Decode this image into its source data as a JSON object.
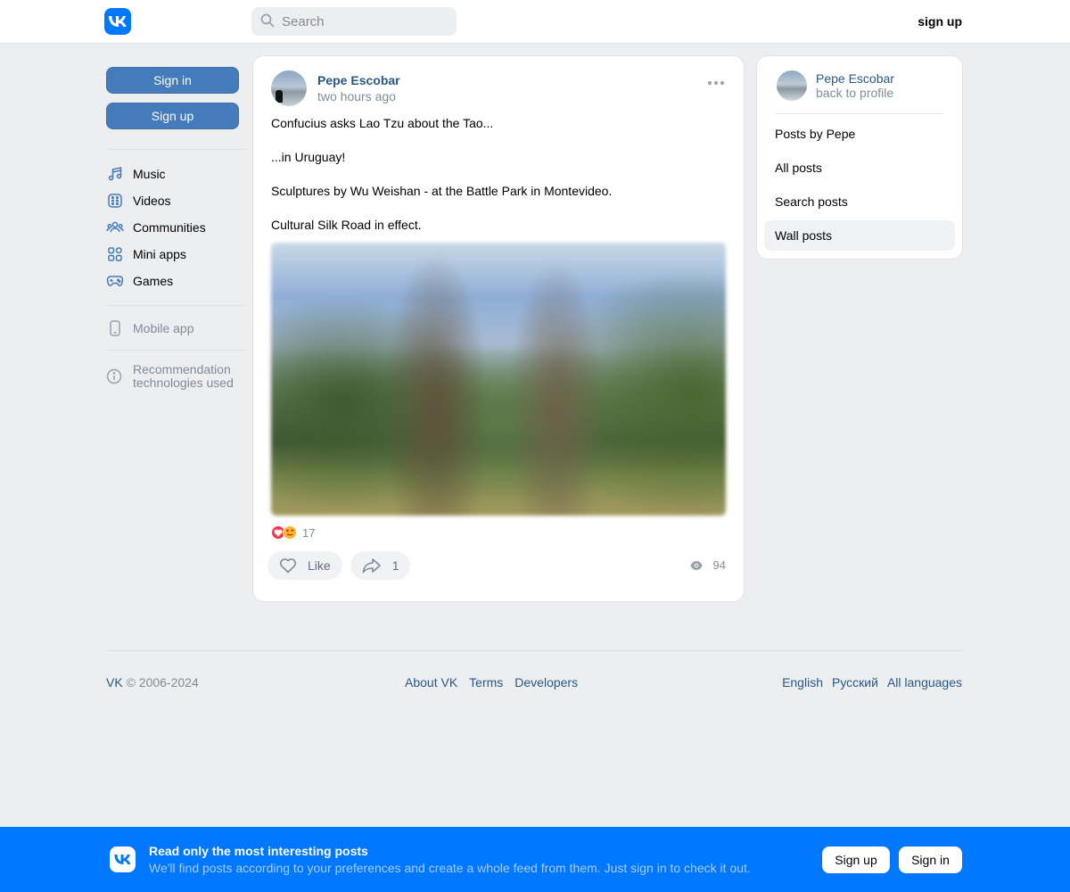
{
  "header": {
    "logo_icon": "vk-logo-icon",
    "search_placeholder": "Search",
    "signup_label": "sign up"
  },
  "sidebar": {
    "signin_label": "Sign in",
    "signup_label": "Sign up",
    "items": [
      {
        "label": "Music",
        "icon": "music-icon"
      },
      {
        "label": "Videos",
        "icon": "video-icon"
      },
      {
        "label": "Communities",
        "icon": "communities-icon"
      },
      {
        "label": "Mini apps",
        "icon": "mini-apps-icon"
      },
      {
        "label": "Games",
        "icon": "gamepad-icon"
      }
    ],
    "mobile_app": "Mobile app",
    "reco_line1": "Recommendation",
    "reco_line2": "technologies used"
  },
  "post": {
    "author": "Pepe Escobar",
    "time": "two hours ago",
    "paragraphs": [
      "Confucius asks Lao Tzu about the Tao...",
      "...in Uruguay!",
      "Sculptures by Wu Weishan - at the Battle Park in Montevideo.",
      "Cultural Silk Road in effect."
    ],
    "reactions_count": "17",
    "like_label": "Like",
    "share_count": "1",
    "views_count": "94"
  },
  "right_menu": {
    "name": "Pepe Escobar",
    "back": "back to profile",
    "items": [
      "Posts by Pepe",
      "All posts",
      "Search posts",
      "Wall posts"
    ],
    "active_index": 3
  },
  "footer": {
    "brand": "VK",
    "copyright": " © 2006-2024",
    "links": [
      "About VK",
      "Terms",
      "Developers"
    ],
    "languages": [
      "English",
      "Русский",
      "All languages"
    ]
  },
  "banner": {
    "title": "Read only the most interesting posts",
    "subtitle": "We'll find posts according to your preferences and create a whole feed from them. Just sign in to check it out.",
    "signup_label": "Sign up",
    "signin_label": "Sign in"
  },
  "colors": {
    "accent": "#0077ff",
    "button_blue": "#447bba",
    "link": "#2a5885",
    "muted": "#818c99",
    "page_bg": "#edeef0"
  }
}
